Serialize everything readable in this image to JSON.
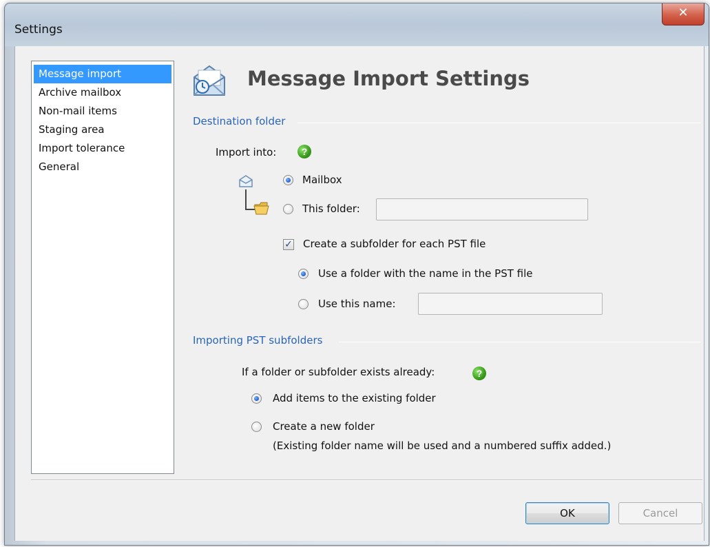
{
  "window": {
    "title": "Settings",
    "close_glyph": "✕"
  },
  "sidebar": {
    "items": [
      {
        "label": "Message import",
        "selected": true
      },
      {
        "label": "Archive mailbox",
        "selected": false
      },
      {
        "label": "Non-mail items",
        "selected": false
      },
      {
        "label": "Staging area",
        "selected": false
      },
      {
        "label": "Import tolerance",
        "selected": false
      },
      {
        "label": "General",
        "selected": false
      }
    ]
  },
  "main": {
    "title": "Message Import Settings",
    "title_icon": "envelope-clock-icon",
    "destination": {
      "group_title": "Destination folder",
      "import_into_label": "Import into:",
      "help_glyph": "?",
      "mailbox_label": "Mailbox",
      "mailbox_selected": true,
      "this_folder_label": "This folder:",
      "this_folder_value": "",
      "create_subfolder_label": "Create a subfolder for each PST file",
      "create_subfolder_checked": true,
      "check_glyph": "✓",
      "use_pst_name_label": "Use a folder with the name in the PST file",
      "use_pst_name_selected": true,
      "use_this_name_label": "Use this name:",
      "use_this_name_value": ""
    },
    "subfolders": {
      "group_title": "Importing PST subfolders",
      "exists_label": "If a folder or subfolder exists already:",
      "help_glyph": "?",
      "add_items_label": "Add items to the existing folder",
      "add_items_selected": true,
      "create_new_label": "Create a new folder",
      "create_new_note": "(Existing folder name will be used and a numbered suffix added.)"
    }
  },
  "footer": {
    "ok_label": "OK",
    "cancel_label": "Cancel",
    "cancel_disabled": true
  },
  "colors": {
    "accent": "#3399ff",
    "group_title": "#2a64b5",
    "help_green": "#3ea01f"
  }
}
